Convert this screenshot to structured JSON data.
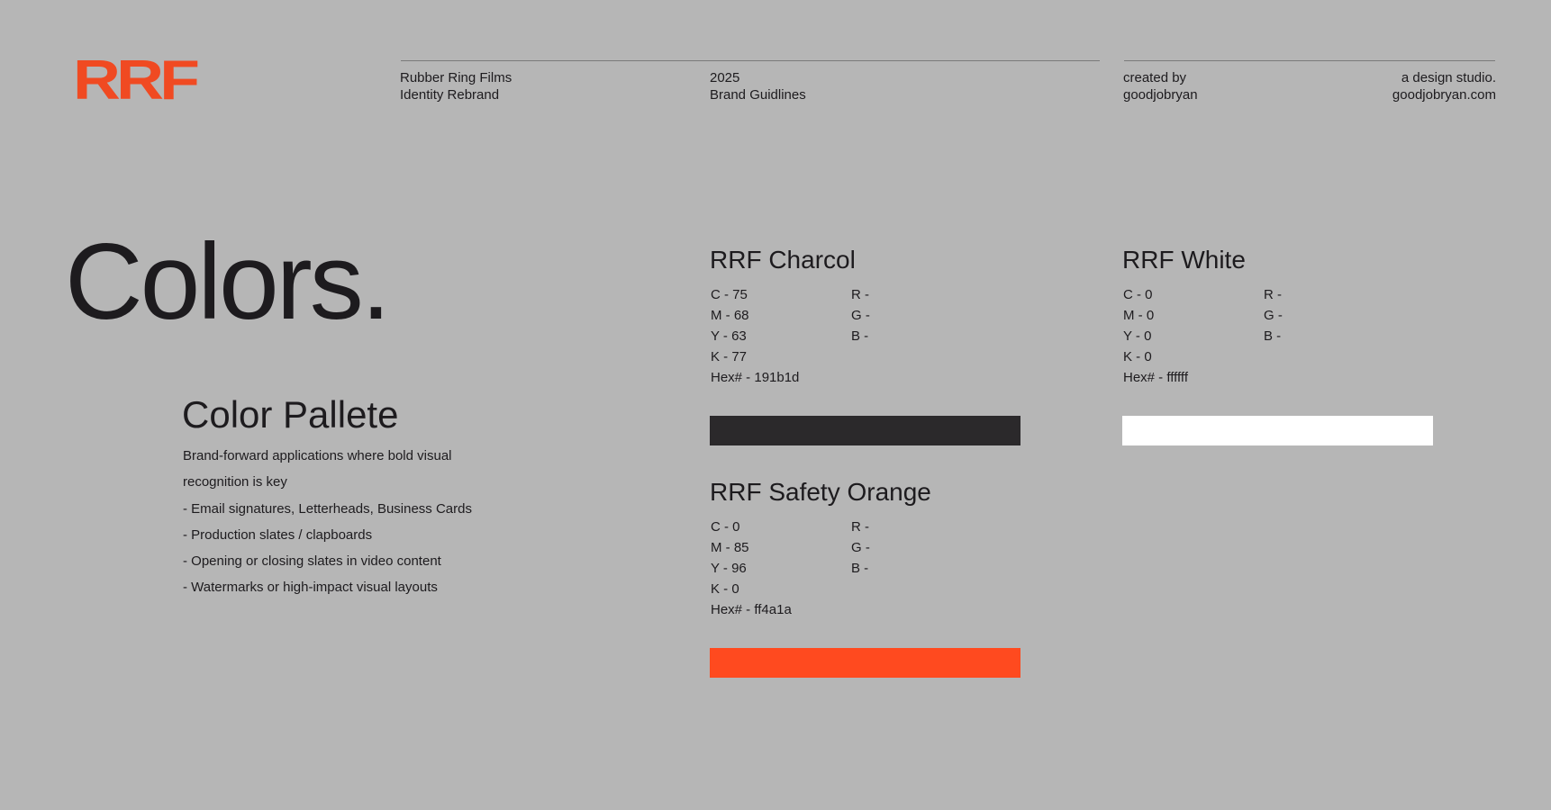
{
  "header": {
    "logo": "RRF",
    "client_line1": "Rubber Ring Films",
    "client_line2": "Identity Rebrand",
    "year_line1": "2025",
    "year_line2": "Brand Guidlines",
    "credit_line1": "created by",
    "credit_line2": "goodjobryan",
    "studio_line1": "a design studio.",
    "studio_line2": "goodjobryan.com"
  },
  "main": {
    "title": "Colors.",
    "palette_title": "Color Pallete",
    "palette_desc_line1": "Brand-forward applications where bold visual",
    "palette_desc_line2": "recognition is key",
    "palette_items": [
      "- Email signatures, Letterheads, Business Cards",
      "- Production slates / clapboards",
      "- Opening or closing slates in video content",
      "- Watermarks or high-impact visual layouts"
    ]
  },
  "swatches": {
    "charcol": {
      "name": "RRF Charcol",
      "c": "C - 75",
      "m": "M - 68",
      "y": "Y - 63",
      "k": "K - 77",
      "hex_label": "Hex# - 191b1d",
      "r": "R -",
      "g": "G -",
      "b": "B -",
      "color": "#2b292b"
    },
    "white": {
      "name": "RRF White",
      "c": "C - 0",
      "m": "M - 0",
      "y": "Y - 0",
      "k": "K - 0",
      "hex_label": "Hex# - ffffff",
      "r": "R -",
      "g": "G -",
      "b": "B -",
      "color": "#ffffff"
    },
    "orange": {
      "name": "RRF Safety Orange",
      "c": "C - 0",
      "m": "M - 85",
      "y": "Y - 96",
      "k": "K - 0",
      "hex_label": "Hex# - ff4a1a",
      "r": "R -",
      "g": "G -",
      "b": "B -",
      "color": "#ff4a1f"
    }
  },
  "colors": {
    "background": "#b6b6b6",
    "brand_orange": "#f04a22",
    "text": "#1d1b1e"
  }
}
